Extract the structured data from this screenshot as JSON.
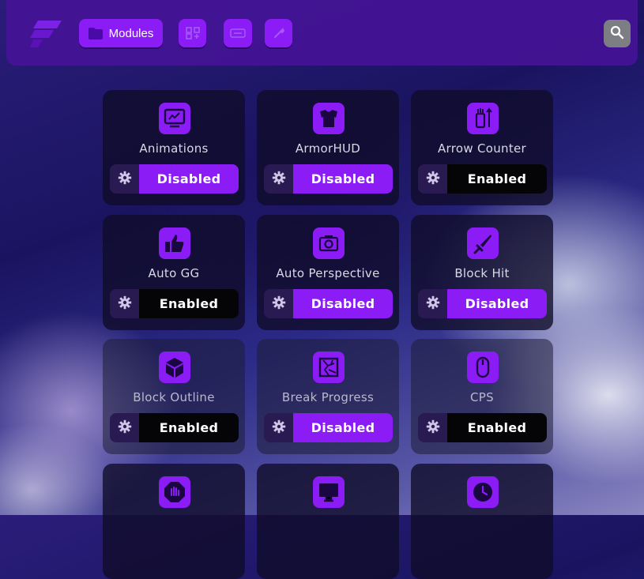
{
  "nav": {
    "modules_label": "Modules",
    "icons": [
      "logo-icon",
      "folder-icon",
      "grid-icon",
      "hud-icon",
      "wrench-icon",
      "search-icon"
    ]
  },
  "colors": {
    "accent": "#8b1cf6",
    "topbar": "#44148f",
    "enabled_bg": "#050508",
    "gear_bg": "#2a1a52"
  },
  "modules": [
    {
      "name": "Animations",
      "state": "Disabled",
      "icon": "animation-monitor-icon"
    },
    {
      "name": "ArmorHUD",
      "state": "Disabled",
      "icon": "armor-chestplate-icon"
    },
    {
      "name": "Arrow Counter",
      "state": "Enabled",
      "icon": "quiver-icon"
    },
    {
      "name": "Auto GG",
      "state": "Enabled",
      "icon": "thumbs-up-icon"
    },
    {
      "name": "Auto Perspective",
      "state": "Disabled",
      "icon": "camera-icon"
    },
    {
      "name": "Block Hit",
      "state": "Disabled",
      "icon": "sword-icon"
    },
    {
      "name": "Block Outline",
      "state": "Enabled",
      "icon": "cube-icon"
    },
    {
      "name": "Break Progress",
      "state": "Disabled",
      "icon": "cracked-block-icon"
    },
    {
      "name": "CPS",
      "state": "Enabled",
      "icon": "mouse-icon"
    },
    {
      "name": "",
      "state": "",
      "icon": "hand-stop-icon"
    },
    {
      "name": "",
      "state": "",
      "icon": "monitor-icon"
    },
    {
      "name": "",
      "state": "",
      "icon": "clock-icon"
    }
  ]
}
